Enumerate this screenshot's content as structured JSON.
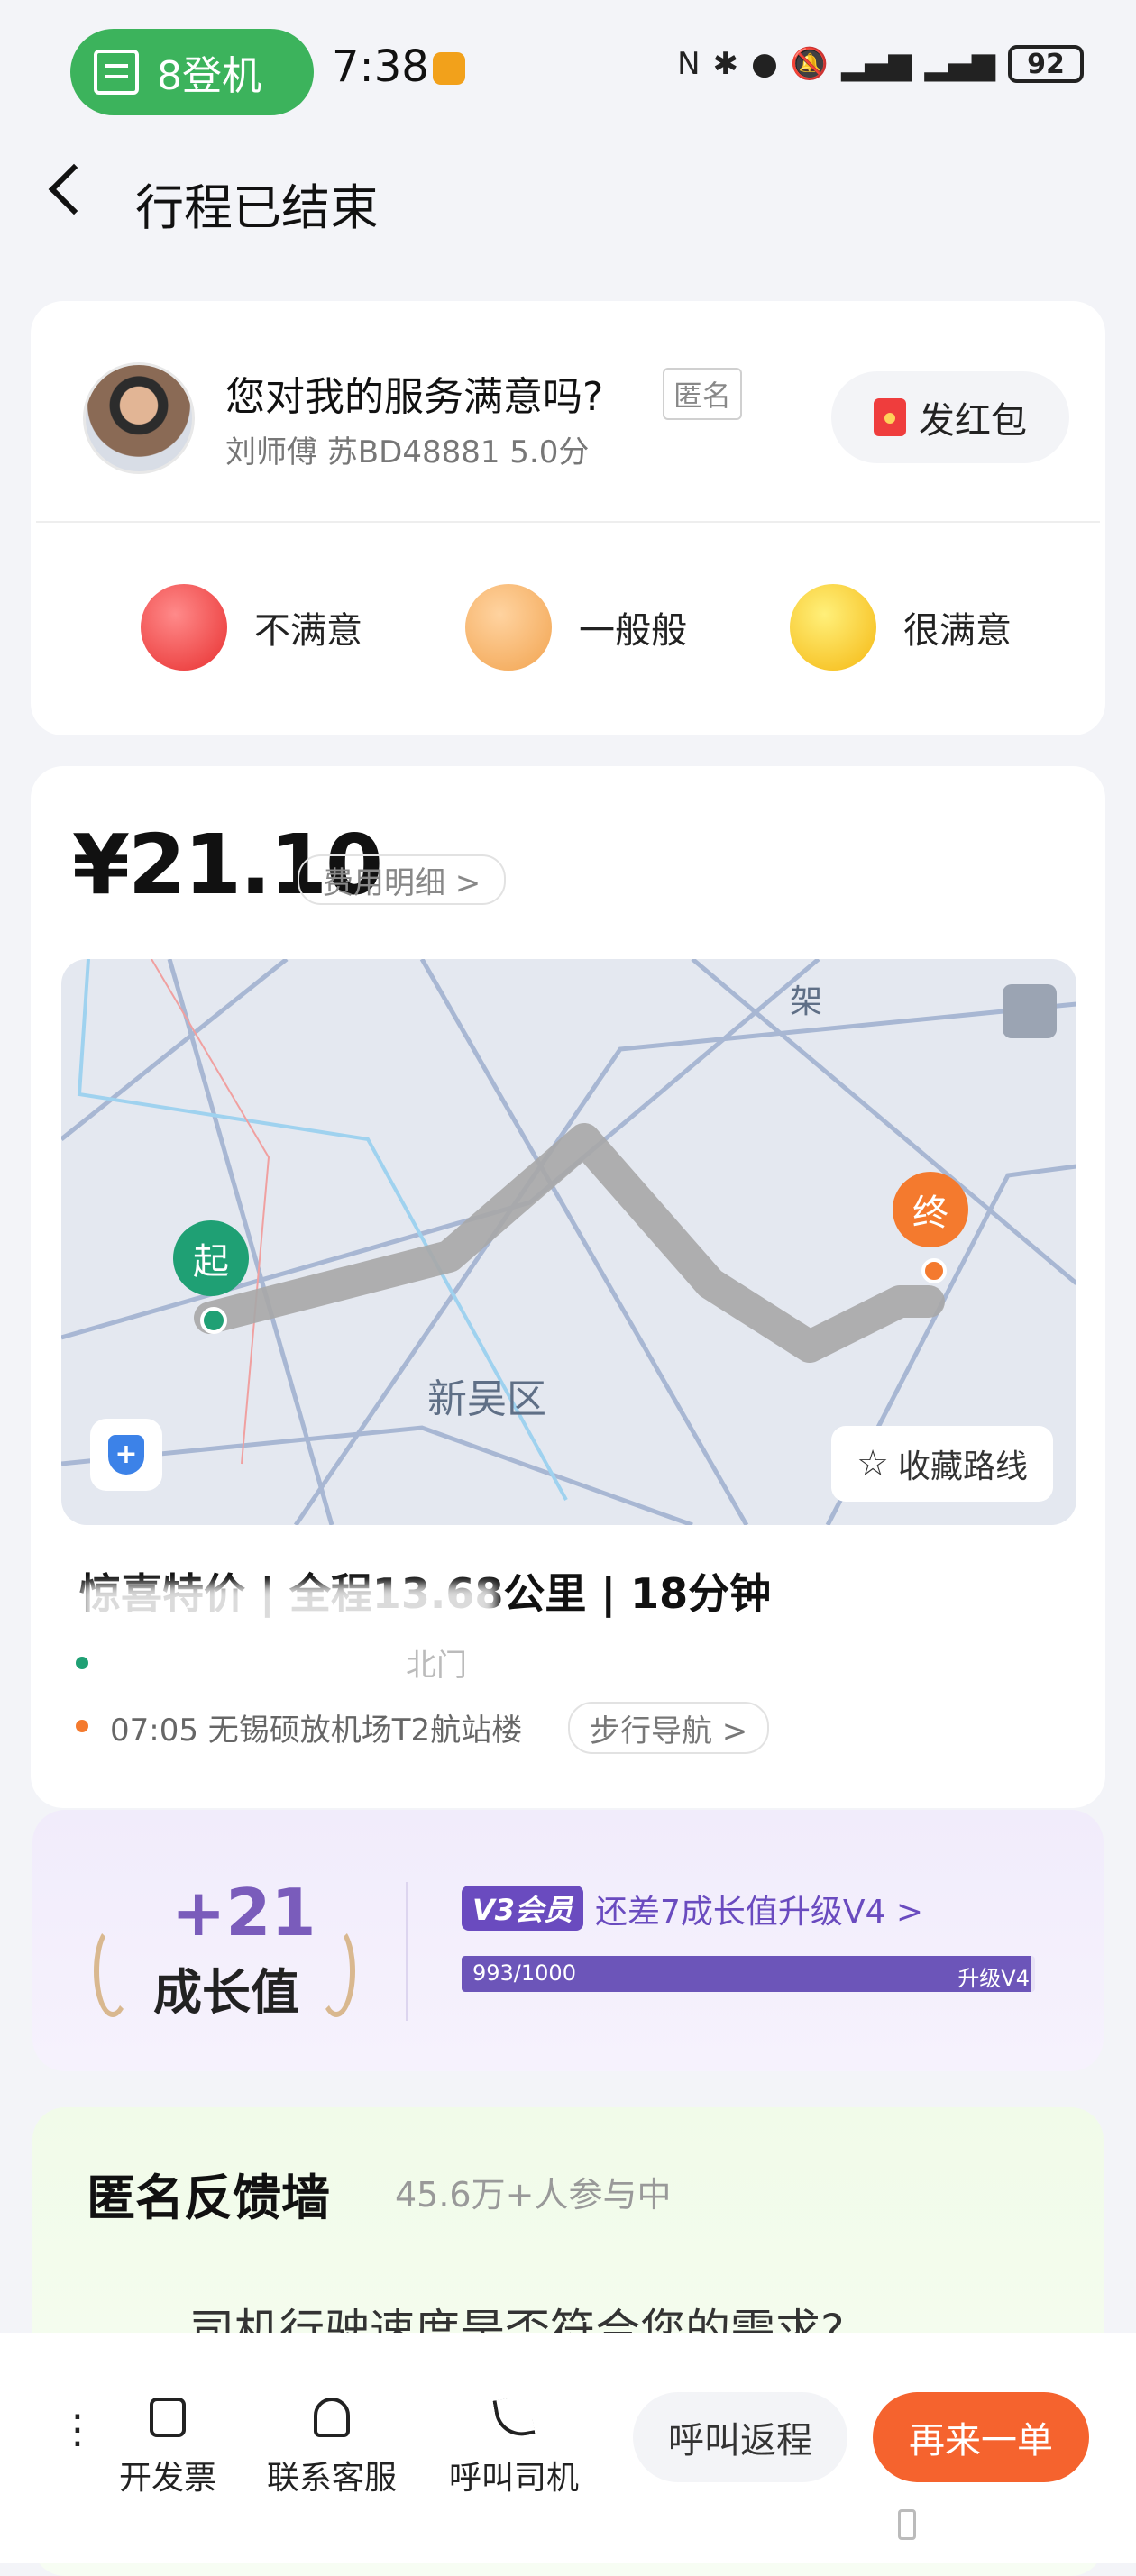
{
  "status_bar": {
    "pill_text": "8登机",
    "time": "7:38",
    "battery": "92"
  },
  "header": {
    "title": "行程已结束"
  },
  "rating_card": {
    "question": "您对我的服务满意吗?",
    "anon_tag": "匿名",
    "driver_info": "刘师傅 苏BD48881 5.0分",
    "red_packet_label": "发红包",
    "options": [
      {
        "label": "不满意",
        "icon": "angry-face-icon",
        "color": "#f04848"
      },
      {
        "label": "一般般",
        "icon": "neutral-face-icon",
        "color": "#f6b060"
      },
      {
        "label": "很满意",
        "icon": "wink-face-icon",
        "color": "#f7c21c"
      }
    ]
  },
  "fare_card": {
    "price": "¥21.10",
    "fee_detail_label": "费用明细 >",
    "map": {
      "start_label": "起",
      "end_label": "终",
      "district_label": "新吴区",
      "road_label": "架",
      "favorite_label": "收藏路线"
    },
    "trip_summary": "惊喜特价 | 全程13.68公里 | 18分钟",
    "start_location": "北门",
    "end_location": "07:05  无锡硕放机场T2航站楼",
    "walk_nav_label": "步行导航 >"
  },
  "growth_card": {
    "points": "+21",
    "points_label": "成长值",
    "member_badge": "V3会员",
    "upgrade_text": "还差7成长值升级V4 >",
    "progress_text": "993/1000",
    "progress_fraction": 0.993,
    "progress_target": "升级V4"
  },
  "feedback_card": {
    "title": "匿名反馈墙",
    "participants": "45.6万+人参与中",
    "question": "司机行驶速度是否符合您的需求?"
  },
  "bottom_bar": {
    "more_label": "⋮",
    "actions": [
      {
        "label": "开发票"
      },
      {
        "label": "联系客服"
      },
      {
        "label": "呼叫司机"
      }
    ],
    "return_call_label": "呼叫返程",
    "again_label": "再来一单"
  }
}
